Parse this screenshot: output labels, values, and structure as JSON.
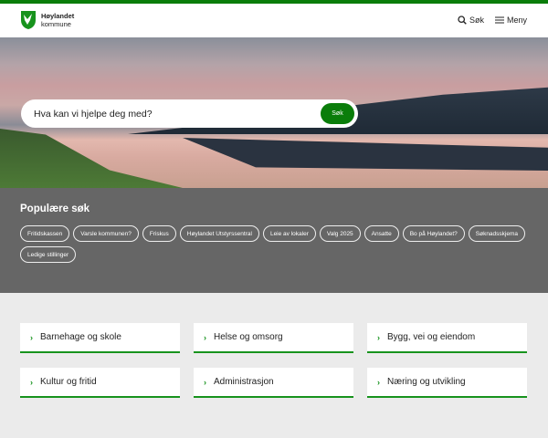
{
  "header": {
    "logo_name": "Høylandet",
    "logo_sub": "kommune",
    "search_label": "Søk",
    "menu_label": "Meny"
  },
  "hero": {
    "search_placeholder": "Hva kan vi hjelpe deg med?",
    "search_button": "Søk"
  },
  "popular": {
    "title": "Populære søk",
    "chips": [
      "Fritidskassen",
      "Varsle kommunen?",
      "Friskus",
      "Høylandet Utstyrssentral",
      "Leie av lokaler",
      "Valg 2025",
      "Ansatte",
      "Bo på Høylandet?",
      "Søknadsskjema",
      "Ledige stillinger"
    ]
  },
  "cards": [
    "Barnehage og skole",
    "Helse og omsorg",
    "Bygg, vei og eiendom",
    "Kultur og fritid",
    "Administrasjon",
    "Næring og utvikling"
  ],
  "colors": {
    "brand": "#0a7d0a",
    "popular_bg": "#666666",
    "page_bg": "#ebebeb"
  }
}
